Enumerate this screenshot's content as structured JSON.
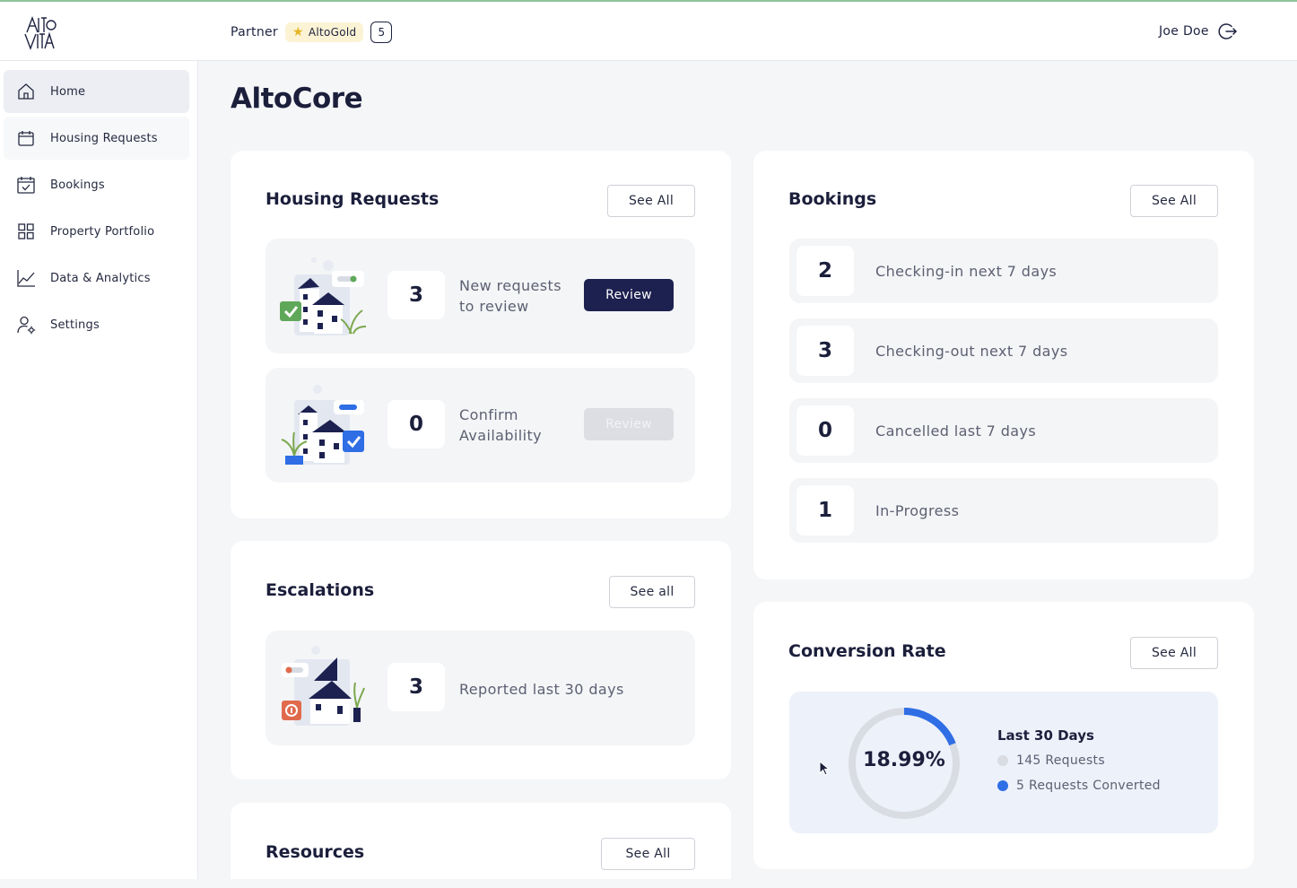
{
  "header": {
    "partner_label": "Partner",
    "tier_label": "AltoGold",
    "tier_count": "5",
    "user_name": "Joe Doe"
  },
  "sidebar": {
    "items": [
      {
        "label": "Home",
        "icon": "home-icon"
      },
      {
        "label": "Housing Requests",
        "icon": "calendar-icon"
      },
      {
        "label": "Bookings",
        "icon": "calendar-check-icon"
      },
      {
        "label": "Property Portfolio",
        "icon": "grid-icon"
      },
      {
        "label": "Data & Analytics",
        "icon": "chart-line-icon"
      },
      {
        "label": "Settings",
        "icon": "user-gear-icon"
      }
    ]
  },
  "page": {
    "title": "AltoCore"
  },
  "housing": {
    "title": "Housing Requests",
    "see_all": "See All",
    "tiles": [
      {
        "count": "3",
        "label_1": "New requests",
        "label_2": "to review",
        "button": "Review"
      },
      {
        "count": "0",
        "label_1": "Confirm",
        "label_2": "Availability",
        "button": "Review"
      }
    ]
  },
  "escalations": {
    "title": "Escalations",
    "see_all": "See all",
    "count": "3",
    "label": "Reported last 30 days"
  },
  "resources": {
    "title": "Resources",
    "see_all": "See All"
  },
  "bookings": {
    "title": "Bookings",
    "see_all": "See All",
    "rows": [
      {
        "count": "2",
        "label": "Checking-in next 7 days"
      },
      {
        "count": "3",
        "label": "Checking-out next 7 days"
      },
      {
        "count": "0",
        "label": "Cancelled last 7 days"
      },
      {
        "count": "1",
        "label": "In-Progress"
      }
    ]
  },
  "conversion": {
    "title": "Conversion Rate",
    "see_all": "See All",
    "percent_label": "18.99%",
    "percent_value": 18.99,
    "period": "Last 30 Days",
    "requests_label": "145 Requests",
    "converted_label": "5 Requests Converted"
  },
  "colors": {
    "navy": "#1c2150",
    "accent_blue": "#2f6ee5",
    "track_gray": "#d9dce2",
    "gold_bg": "#fbf3d4",
    "success_green": "#5fa85a"
  }
}
